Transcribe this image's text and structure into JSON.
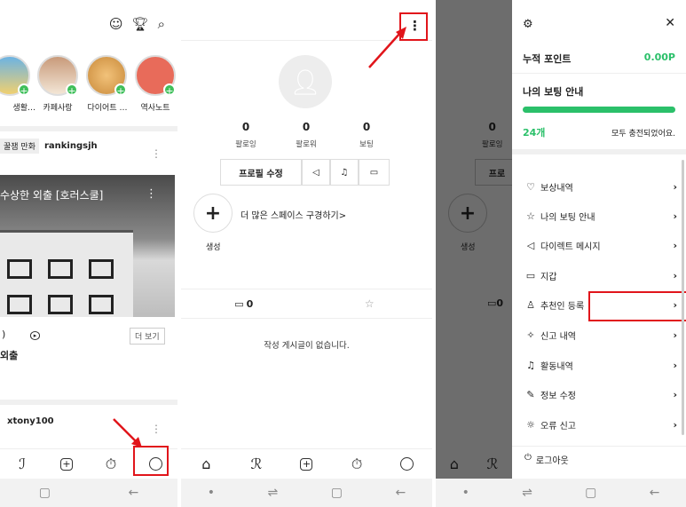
{
  "panel1": {
    "stories": [
      {
        "label": "생활…"
      },
      {
        "label": "카페사랑"
      },
      {
        "label": "다이어트 …"
      },
      {
        "label": "역사노트"
      }
    ],
    "post1": {
      "badge": "꿀잼 만화",
      "author": "rankingsjh",
      "title": "수상한 외출 [호러스쿨]",
      "more_label": "더 보기",
      "caption": "외출"
    },
    "post2": {
      "author": "xtony100"
    }
  },
  "panel2": {
    "stats": [
      {
        "value": "0",
        "label": "팔로잉"
      },
      {
        "value": "0",
        "label": "팔로워"
      },
      {
        "value": "0",
        "label": "보팅"
      }
    ],
    "edit_profile": "프로필 수정",
    "explore_text": "더 많은 스페이스 구경하기>",
    "create_label": "생성",
    "post_count": "0",
    "empty_text": "작성 게시글이 없습니다."
  },
  "panel3": {
    "bg_stat_value": "0",
    "bg_stat_label": "팔로잉",
    "bg_create": "생성",
    "bg_count": "0",
    "bg_btn": "프로",
    "points_label": "누적 포인트",
    "points_value": "0.00P",
    "voting_title": "나의 보팅 안내",
    "voting_progress": 1.0,
    "voting_count": "24개",
    "voting_status": "모두 충전되었어요.",
    "menu": [
      {
        "icon": "heart-icon",
        "label": "보상내역"
      },
      {
        "icon": "star-icon",
        "label": "나의 보팅 안내"
      },
      {
        "icon": "send-icon",
        "label": "다이렉트 메시지"
      },
      {
        "icon": "wallet-icon",
        "label": "지갑"
      },
      {
        "icon": "person-icon",
        "label": "추천인 등록"
      },
      {
        "icon": "report-icon",
        "label": "신고 내역"
      },
      {
        "icon": "bell-icon",
        "label": "활동내역"
      },
      {
        "icon": "edit-icon",
        "label": "정보 수정"
      },
      {
        "icon": "bug-icon",
        "label": "오류 신고"
      }
    ],
    "logout": "로그아웃"
  },
  "colors": {
    "accent_green": "#2bc06a",
    "highlight_red": "#e1151b"
  }
}
